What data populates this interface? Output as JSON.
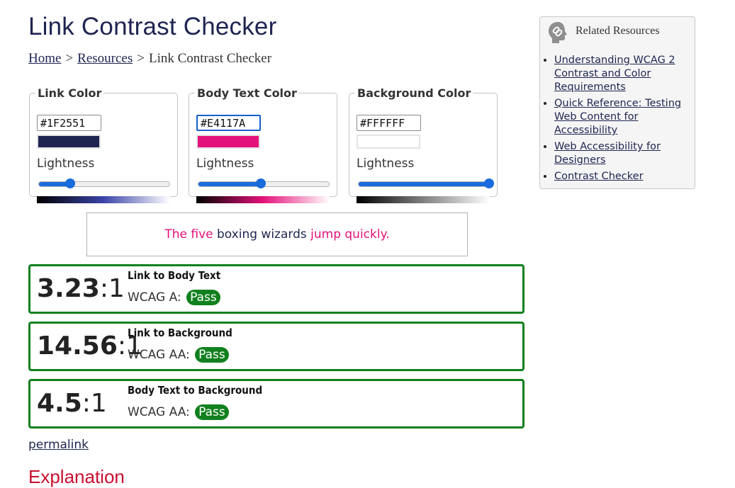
{
  "page": {
    "title": "Link Contrast Checker",
    "explanation_heading": "Explanation",
    "permalink_label": "permalink"
  },
  "breadcrumb": {
    "home": "Home",
    "resources": "Resources",
    "separator": ">",
    "current": "Link Contrast Checker"
  },
  "pickers": [
    {
      "legend": "Link Color",
      "value": "#1F2551",
      "swatch": "#1F2551",
      "lightness_label": "Lightness",
      "lightness_percent": 24,
      "gradient_mid": "#3a44a8"
    },
    {
      "legend": "Body Text Color",
      "value": "#E4117A",
      "swatch": "#E4117A",
      "lightness_label": "Lightness",
      "lightness_percent": 48,
      "gradient_mid": "#e4117a"
    },
    {
      "legend": "Background Color",
      "value": "#FFFFFF",
      "swatch": "#FFFFFF",
      "lightness_label": "Lightness",
      "lightness_percent": 100,
      "gradient_mid": "#808080"
    }
  ],
  "sample": {
    "part1": "The five",
    "part2": "boxing wizards",
    "part3": "jump quickly."
  },
  "results": [
    {
      "ratio": "3.23",
      "suffix": ":1",
      "title": "Link to Body Text",
      "level": "WCAG A:",
      "status": "Pass"
    },
    {
      "ratio": "14.56",
      "suffix": ":1",
      "title": "Link to Background",
      "level": "WCAG AA:",
      "status": "Pass"
    },
    {
      "ratio": "4.5",
      "suffix": ":1",
      "title": "Body Text to Background",
      "level": "WCAG AA:",
      "status": "Pass"
    }
  ],
  "related": {
    "heading": "Related Resources",
    "icon": "link-icon",
    "links": [
      "Understanding WCAG 2 Contrast and Color Requirements",
      "Quick Reference: Testing Web Content for Accessibility",
      "Web Accessibility for Designers",
      "Contrast Checker"
    ]
  },
  "colors": {
    "link": "#1F2551",
    "body_text": "#E4117A",
    "background": "#FFFFFF",
    "pass": "#11801E",
    "slider_accent": "#1A6BDC",
    "explanation": "#C8102E"
  }
}
